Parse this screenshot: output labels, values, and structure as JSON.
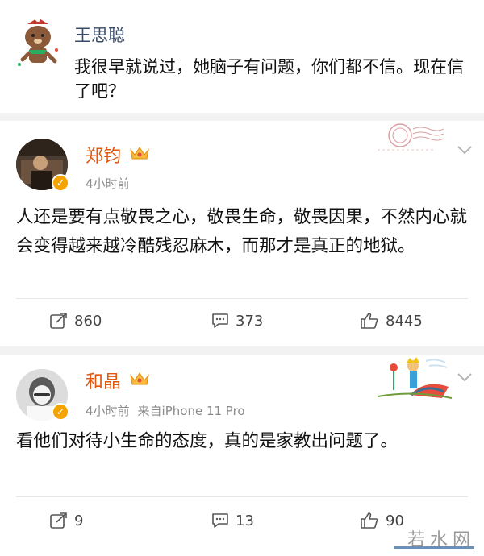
{
  "reply": {
    "name": "王思聪",
    "text": "我很早就说过，她脑子有问题，你们都不信。现在信了吧？"
  },
  "posts": [
    {
      "name": "郑钧",
      "time": "4小时前",
      "source": "",
      "text": "人还是要有点敬畏之心，敬畏生命，敬畏因果，不然内心就会变得越来越冷酷残忍麻木，而那才是真正的地狱。",
      "forwards": "860",
      "comments": "373",
      "likes": "8445"
    },
    {
      "name": "和晶",
      "time": "4小时前",
      "source": "来自iPhone 11 Pro",
      "text": "看他们对待小生命的态度，真的是家教出问题了。",
      "forwards": "9",
      "comments": "13",
      "likes": "90"
    }
  ],
  "colors": {
    "username": "#e2580f",
    "reply_name": "#3a4b6a",
    "verified_badge": "#f4a300",
    "meta": "#8a8a8a"
  },
  "icons": [
    "bear-avatar-icon",
    "crown-icon",
    "verified-badge-icon",
    "chevron-down-icon",
    "forward-icon",
    "comment-icon",
    "like-icon"
  ],
  "watermark": "若水网"
}
